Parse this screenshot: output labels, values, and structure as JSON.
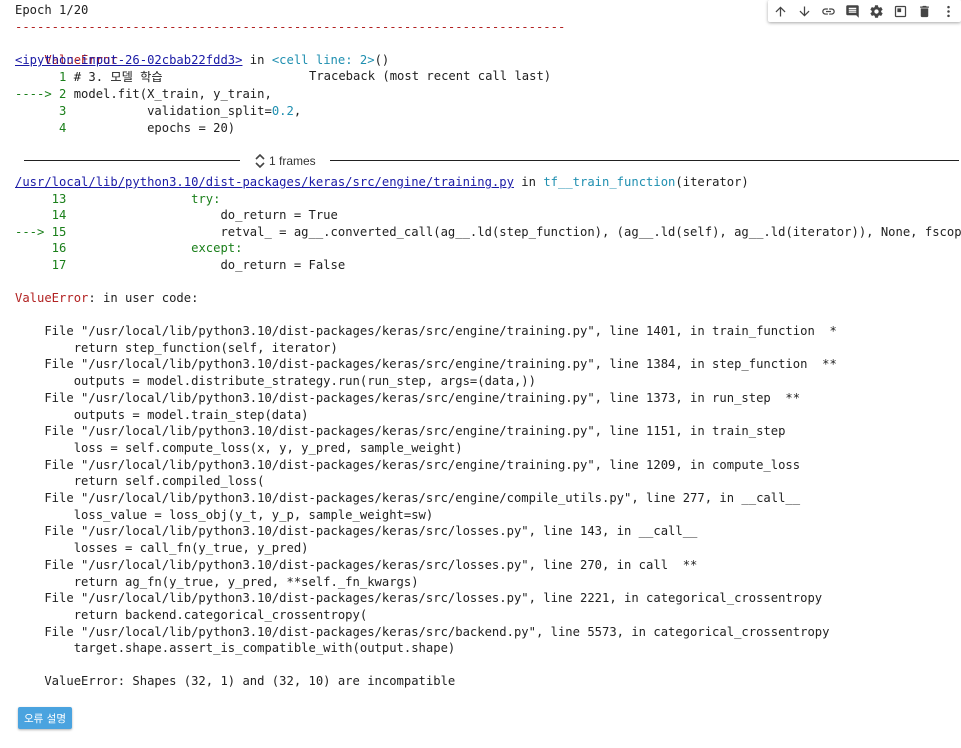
{
  "output": {
    "epoch_line": "Epoch 1/20",
    "dash_line": "---------------------------------------------------------------------------",
    "error_name": "ValueError",
    "traceback_label": "Traceback (most recent call last)",
    "input_link": "<ipython-input-26-02cbab22fdd3>",
    "in_word": " in ",
    "cell_ref": "<cell line: 2>",
    "cell_ref_parens": "()",
    "code_lines": [
      {
        "marker": "      1 ",
        "code": "# 3. 모델 학습"
      },
      {
        "marker": "----> 2 ",
        "code": "model.fit(X_train, y_train,"
      },
      {
        "marker": "      3 ",
        "code": "          validation_split=",
        "num": "0.2",
        "tail": ","
      },
      {
        "marker": "      4 ",
        "code": "          epochs = 20)"
      }
    ],
    "frames_label": "1 frames",
    "training_link": "/usr/local/lib/python3.10/dist-packages/keras/src/engine/training.py",
    "training_func": "tf__train_function",
    "training_args": "(iterator)",
    "frame_lines": [
      {
        "marker": "     13 ",
        "code": "                try:"
      },
      {
        "marker": "     14 ",
        "code": "                    do_return = True"
      },
      {
        "marker": "---> 15 ",
        "code": "                    retval_ = ag__.converted_call(ag__.ld(step_function), (ag__.ld(self), ag__.ld(iterator)), None, fscope)"
      },
      {
        "marker": "     16 ",
        "code": "                except:"
      },
      {
        "marker": "     17 ",
        "code": "                    do_return = False"
      }
    ],
    "user_code_header": "ValueError",
    "user_code_tail": ": in user code:",
    "trace_lines": [
      "    File \"/usr/local/lib/python3.10/dist-packages/keras/src/engine/training.py\", line 1401, in train_function  *",
      "        return step_function(self, iterator)",
      "    File \"/usr/local/lib/python3.10/dist-packages/keras/src/engine/training.py\", line 1384, in step_function  **",
      "        outputs = model.distribute_strategy.run(run_step, args=(data,))",
      "    File \"/usr/local/lib/python3.10/dist-packages/keras/src/engine/training.py\", line 1373, in run_step  **",
      "        outputs = model.train_step(data)",
      "    File \"/usr/local/lib/python3.10/dist-packages/keras/src/engine/training.py\", line 1151, in train_step",
      "        loss = self.compute_loss(x, y, y_pred, sample_weight)",
      "    File \"/usr/local/lib/python3.10/dist-packages/keras/src/engine/training.py\", line 1209, in compute_loss",
      "        return self.compiled_loss(",
      "    File \"/usr/local/lib/python3.10/dist-packages/keras/src/engine/compile_utils.py\", line 277, in __call__",
      "        loss_value = loss_obj(y_t, y_p, sample_weight=sw)",
      "    File \"/usr/local/lib/python3.10/dist-packages/keras/src/losses.py\", line 143, in __call__",
      "        losses = call_fn(y_true, y_pred)",
      "    File \"/usr/local/lib/python3.10/dist-packages/keras/src/losses.py\", line 270, in call  **",
      "        return ag_fn(y_true, y_pred, **self._fn_kwargs)",
      "    File \"/usr/local/lib/python3.10/dist-packages/keras/src/losses.py\", line 2221, in categorical_crossentropy",
      "        return backend.categorical_crossentropy(",
      "    File \"/usr/local/lib/python3.10/dist-packages/keras/src/backend.py\", line 5573, in categorical_crossentropy",
      "        target.shape.assert_is_compatible_with(output.shape)"
    ],
    "final_error": "    ValueError: Shapes (32, 1) and (32, 10) are incompatible"
  },
  "toolbar": {
    "icons": [
      "arrow-up-icon",
      "arrow-down-icon",
      "link-icon",
      "comment-icon",
      "settings-icon",
      "mirror-cell-icon",
      "delete-icon",
      "more-icon"
    ]
  },
  "explain_button": "오류 설명",
  "colors": {
    "error_red": "#b22222",
    "line_green": "#1a7f1a",
    "link_blue": "#1a1aa6",
    "button_blue": "#4aa3df"
  }
}
